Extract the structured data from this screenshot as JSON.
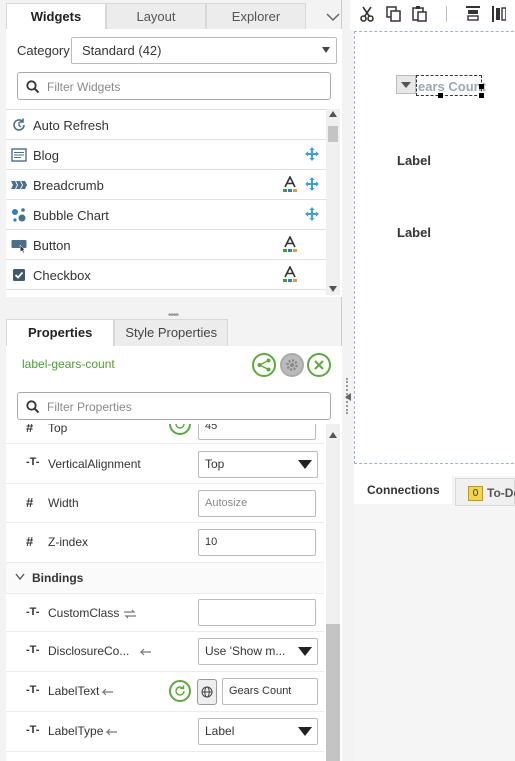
{
  "top_tabs": [
    "Widgets",
    "Layout",
    "Explorer"
  ],
  "category": {
    "label": "Category",
    "value": "Standard (42)"
  },
  "filter_widgets_placeholder": "Filter Widgets",
  "widgets": [
    {
      "label": "Auto Refresh",
      "icon": "refresh-icon",
      "a": false,
      "m": false
    },
    {
      "label": "Blog",
      "icon": "blog-icon",
      "a": false,
      "m": true
    },
    {
      "label": "Breadcrumb",
      "icon": "breadcrumb-icon",
      "a": true,
      "m": true
    },
    {
      "label": "Bubble Chart",
      "icon": "bubble-chart-icon",
      "a": false,
      "m": true
    },
    {
      "label": "Button",
      "icon": "button-icon",
      "a": true,
      "m": false
    },
    {
      "label": "Checkbox",
      "icon": "checkbox-icon",
      "a": true,
      "m": false
    }
  ],
  "prop_tabs": [
    "Properties",
    "Style Properties"
  ],
  "selected_widget": "label-gears-count",
  "filter_properties_placeholder": "Filter Properties",
  "properties": {
    "top": {
      "label": "Top",
      "value": "45"
    },
    "vertical_alignment": {
      "label": "VerticalAlignment",
      "value": "Top"
    },
    "width": {
      "label": "Width",
      "placeholder": "Autosize"
    },
    "zindex": {
      "label": "Z-index",
      "value": "10"
    },
    "bindings_header": "Bindings",
    "custom_class": {
      "label": "CustomClass",
      "value": ""
    },
    "disclosure": {
      "label": "DisclosureCo...",
      "value": "Use 'Show m..."
    },
    "label_text": {
      "label": "LabelText",
      "value": "Gears Count"
    },
    "label_type": {
      "label": "LabelType",
      "value": "Label"
    }
  },
  "canvas": {
    "selected_text": "ears Count",
    "labels": [
      "Label",
      "Label"
    ]
  },
  "bottom_tabs": [
    "Connections",
    "To-Do"
  ],
  "todo_count": "0",
  "colors": {
    "accent_green": "#5aaa3a",
    "selection_text": "#9aa8b5",
    "canvas_border": "#9fb3c8"
  }
}
